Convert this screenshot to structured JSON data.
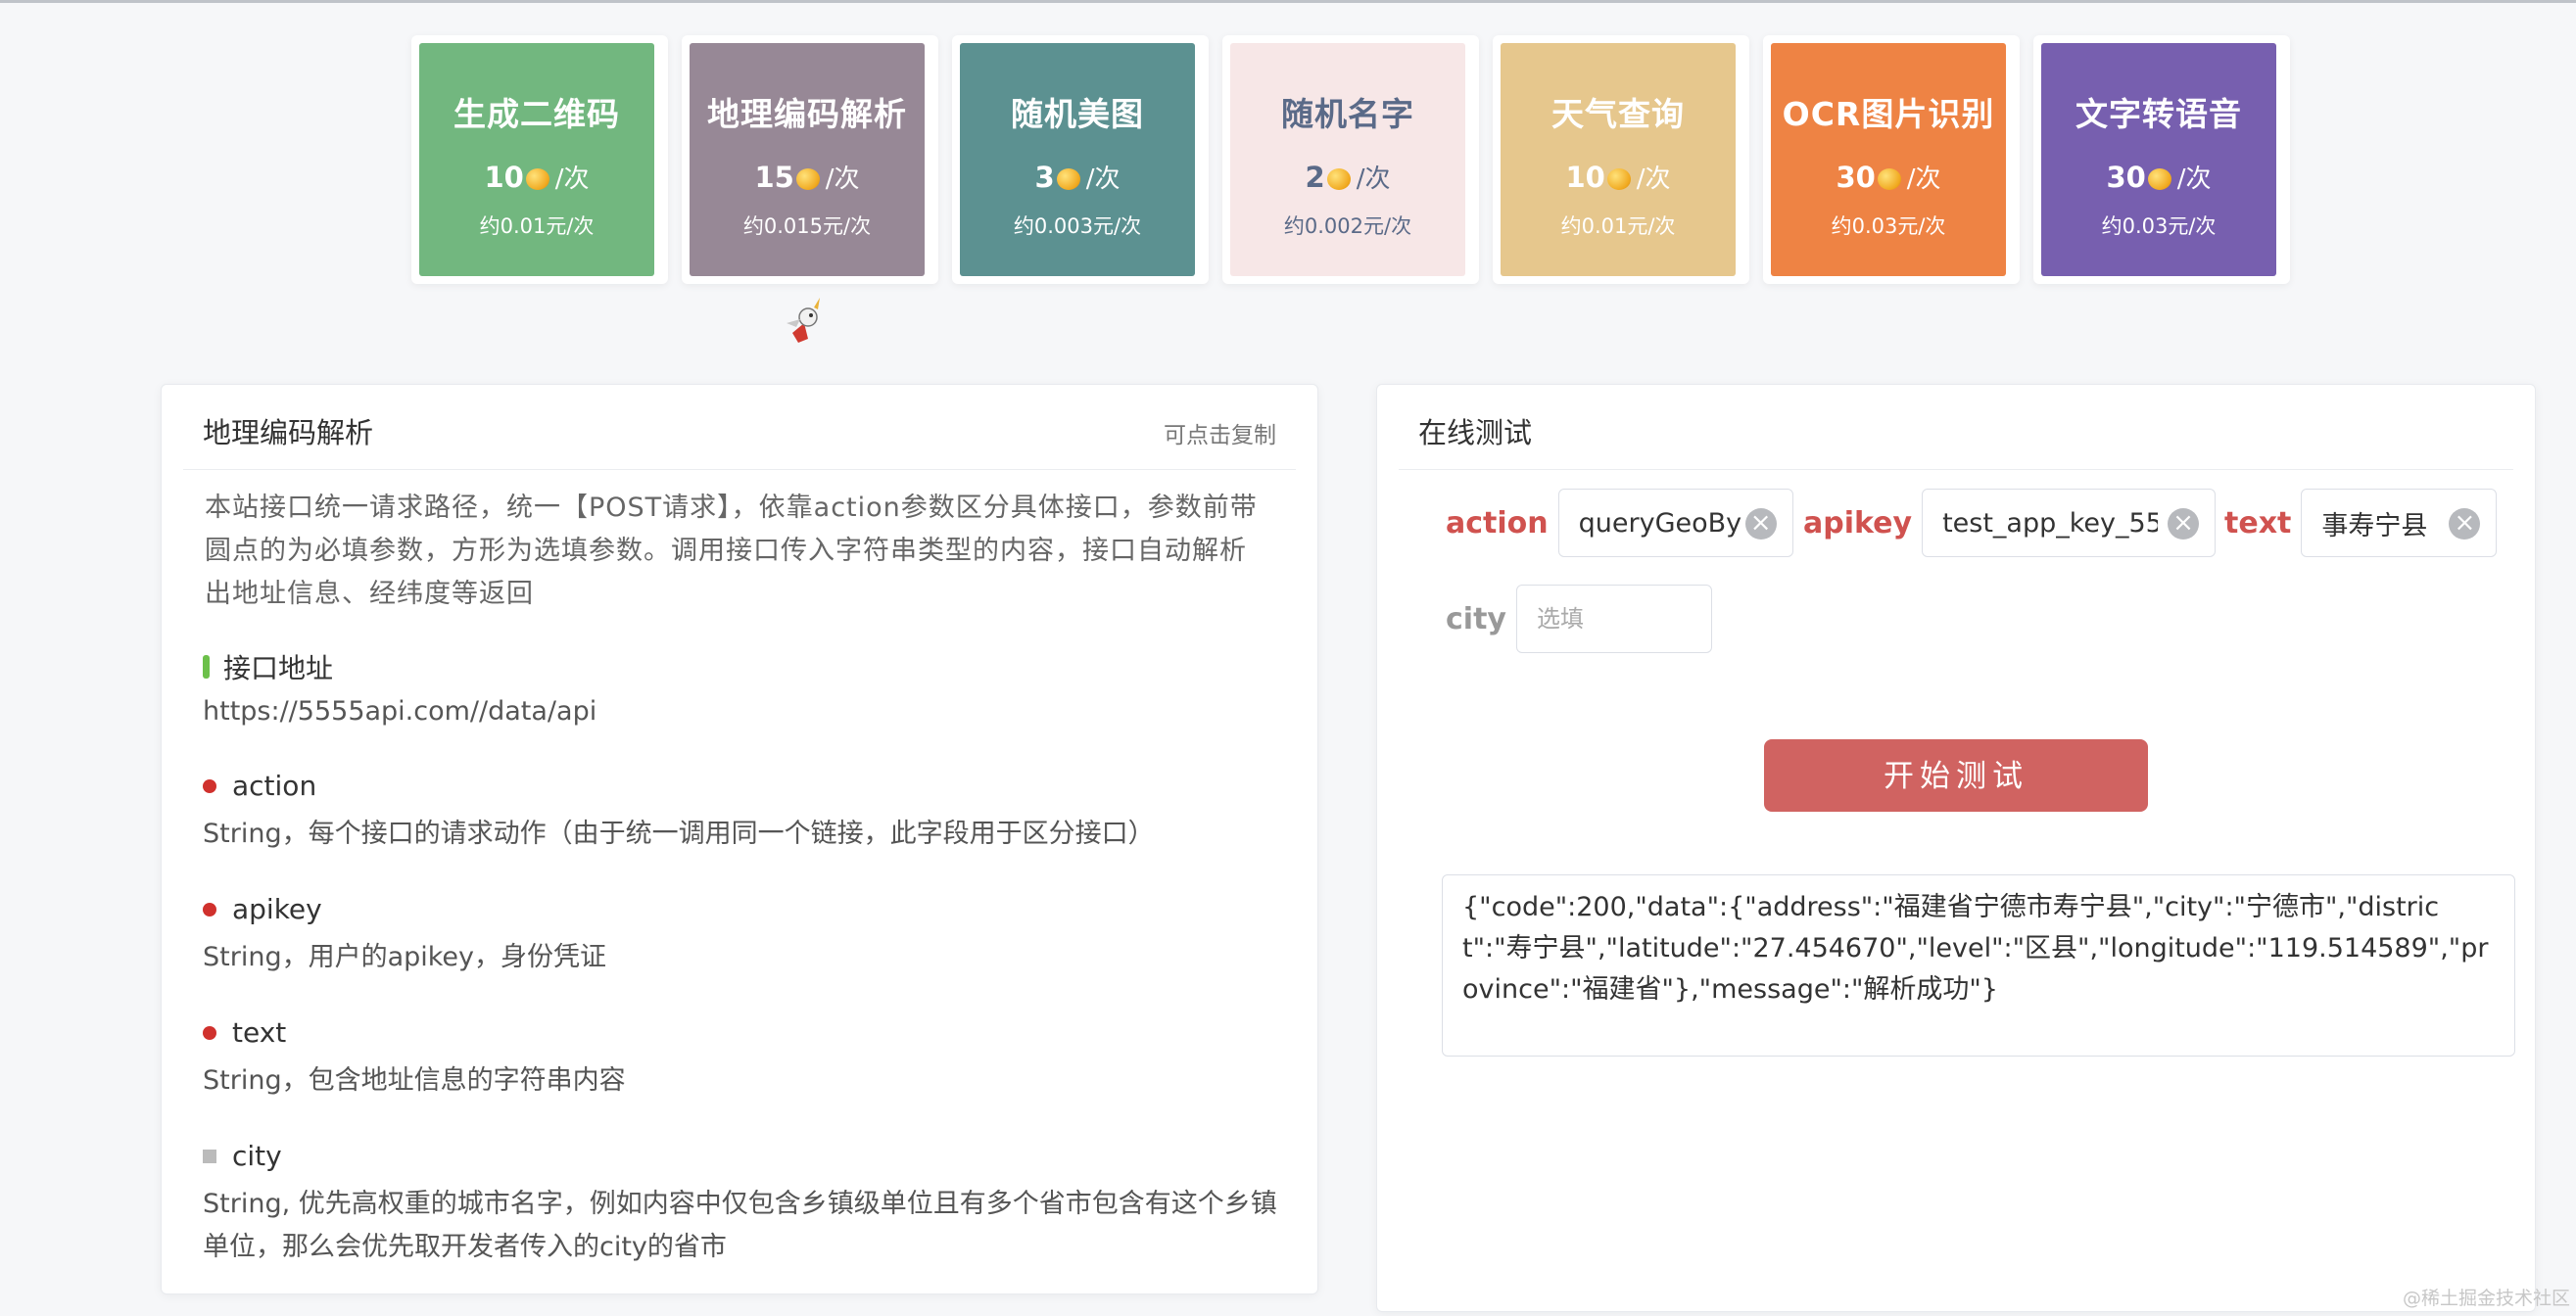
{
  "cards": [
    {
      "title": "生成二维码",
      "price": "10",
      "unit": "/次",
      "yuan": "约0.01元/次",
      "color": "#72b77f"
    },
    {
      "title": "地理编码解析",
      "price": "15",
      "unit": "/次",
      "yuan": "约0.015元/次",
      "color": "#978896"
    },
    {
      "title": "随机美图",
      "price": "3",
      "unit": "/次",
      "yuan": "约0.003元/次",
      "color": "#5c9191"
    },
    {
      "title": "随机名字",
      "price": "2",
      "unit": "/次",
      "yuan": "约0.002元/次",
      "color": "#f7e7e7"
    },
    {
      "title": "天气查询",
      "price": "10",
      "unit": "/次",
      "yuan": "约0.01元/次",
      "color": "#e6c78d"
    },
    {
      "title": "OCR图片识别",
      "price": "30",
      "unit": "/次",
      "yuan": "约0.03元/次",
      "color": "#ee8344"
    },
    {
      "title": "文字转语音",
      "price": "30",
      "unit": "/次",
      "yuan": "约0.03元/次",
      "color": "#775faf"
    }
  ],
  "doc": {
    "title": "地理编码解析",
    "copy_label": "可点击复制",
    "intro": "本站接口统一请求路径，统一【POST请求】，依靠action参数区分具体接口，参数前带圆点的为必填参数，方形为选填参数。调用接口传入字符串类型的内容，接口自动解析出地址信息、经纬度等返回",
    "endpoint_label": "接口地址",
    "endpoint": "https://5555api.com//data/api",
    "params": [
      {
        "name": "action",
        "desc": "String，每个接口的请求动作（由于统一调用同一个链接，此字段用于区分接口）"
      },
      {
        "name": "apikey",
        "desc": "String，用户的apikey，身份凭证"
      },
      {
        "name": "text",
        "desc": "String，包含地址信息的字符串内容"
      },
      {
        "name": "city",
        "desc": "String, 优先高权重的城市名字，例如内容中仅包含乡镇级单位且有多个省市包含有这个乡镇单位，那么会优先取开发者传入的city的省市"
      }
    ]
  },
  "test": {
    "title": "在线测试",
    "fields": [
      {
        "label": "action",
        "value": "queryGeoBy"
      },
      {
        "label": "apikey",
        "value": "test_app_key_55"
      },
      {
        "label": "text",
        "value": "事寿宁县"
      },
      {
        "label": "city",
        "placeholder": "选填"
      }
    ],
    "button": "开始测试",
    "result": "{\"code\":200,\"data\":{\"address\":\"福建省宁德市寿宁县\",\"city\":\"宁德市\",\"district\":\"寿宁县\",\"latitude\":\"27.454670\",\"level\":\"区县\",\"longitude\":\"119.514589\",\"province\":\"福建省\"},\"message\":\"解析成功\"}"
  },
  "watermark": "@稀土掘金技术社区"
}
